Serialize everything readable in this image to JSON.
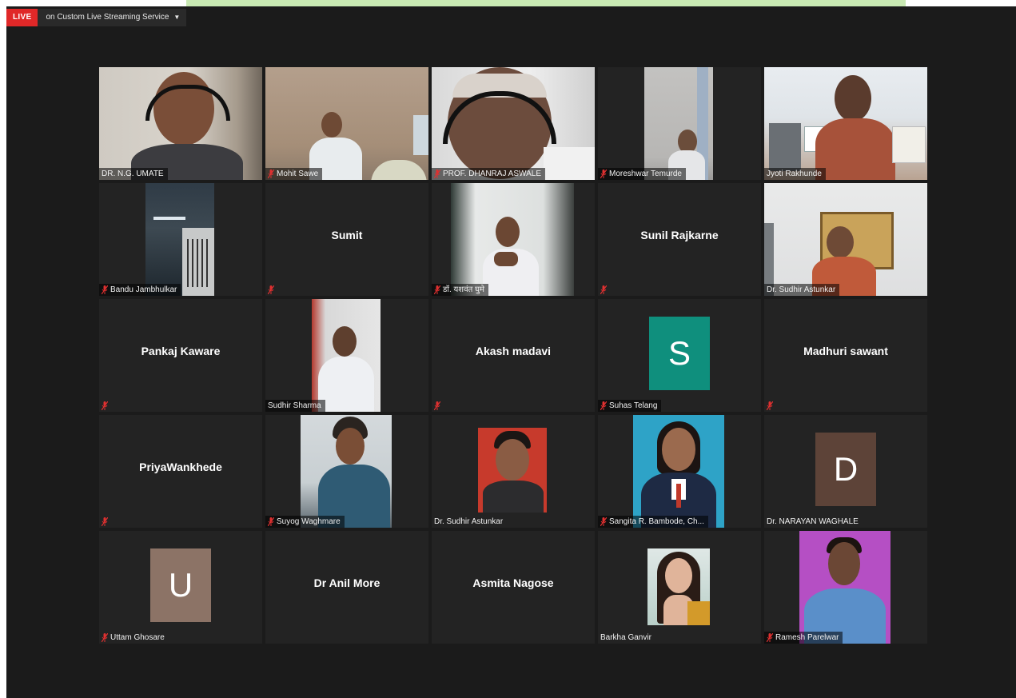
{
  "live_bar": {
    "badge": "LIVE",
    "service": "on Custom Live Streaming Service"
  },
  "colors": {
    "window_bg": "#1b1b1b",
    "tile_bg": "#232323",
    "active_border": "#c6e36a",
    "live_red": "#e02828",
    "mute_red": "#e03030"
  },
  "participants": [
    {
      "name": "DR. N.G. UMATE",
      "muted": false,
      "video": true,
      "active": false
    },
    {
      "name": "Mohit Sawe",
      "muted": true,
      "video": true,
      "active": false
    },
    {
      "name": "PROF. DHANRAJ ASWALE",
      "muted": true,
      "video": true,
      "active": false
    },
    {
      "name": "Moreshwar Temurde",
      "muted": true,
      "video": true,
      "active": false
    },
    {
      "name": "Jyoti Rakhunde",
      "muted": false,
      "video": true,
      "active": true
    },
    {
      "name": "Bandu Jambhulkar",
      "muted": true,
      "video": true,
      "active": false
    },
    {
      "name": "",
      "display_name": "Sumit",
      "muted": true,
      "video": false,
      "active": false
    },
    {
      "name": "डॉ. यशवंत घुमे",
      "muted": true,
      "video": true,
      "active": false
    },
    {
      "name": "",
      "display_name": "Sunil Rajkarne",
      "muted": true,
      "video": false,
      "active": false
    },
    {
      "name": "Dr. Sudhir Astunkar",
      "muted": false,
      "video": true,
      "active": false
    },
    {
      "name": "",
      "display_name": "Pankaj Kaware",
      "muted": true,
      "video": false,
      "active": false
    },
    {
      "name": "Sudhir Sharma",
      "muted": false,
      "video": true,
      "active": false
    },
    {
      "name": "",
      "display_name": "Akash madavi",
      "muted": true,
      "video": false,
      "active": false
    },
    {
      "name": "Suhas Telang",
      "muted": true,
      "video": false,
      "avatar": "S",
      "avatar_color": "#0f8f7d",
      "active": false
    },
    {
      "name": "",
      "display_name": "Madhuri sawant",
      "muted": true,
      "video": false,
      "active": false
    },
    {
      "name": "",
      "display_name": "PriyaWankhede",
      "muted": true,
      "video": false,
      "active": false
    },
    {
      "name": "Suyog Waghmare",
      "muted": true,
      "video": true,
      "active": false
    },
    {
      "name": "Dr. Sudhir Astunkar",
      "muted": false,
      "video": true,
      "active": false
    },
    {
      "name": "Sangita R. Bambode, Ch...",
      "muted": true,
      "video": true,
      "active": false
    },
    {
      "name": "Dr. NARAYAN WAGHALE",
      "muted": false,
      "video": false,
      "avatar": "D",
      "avatar_color": "#5d4338",
      "active": false
    },
    {
      "name": "Uttam Ghosare",
      "muted": true,
      "video": false,
      "avatar": "U",
      "avatar_color": "#8c7366",
      "active": false
    },
    {
      "name": "",
      "display_name": "Dr Anil More",
      "muted": false,
      "video": false,
      "active": false
    },
    {
      "name": "",
      "display_name": "Asmita Nagose",
      "muted": false,
      "video": false,
      "active": false
    },
    {
      "name": "Barkha Ganvir",
      "muted": false,
      "video": true,
      "active": false
    },
    {
      "name": "Ramesh Parelwar",
      "muted": true,
      "video": true,
      "active": false
    }
  ]
}
